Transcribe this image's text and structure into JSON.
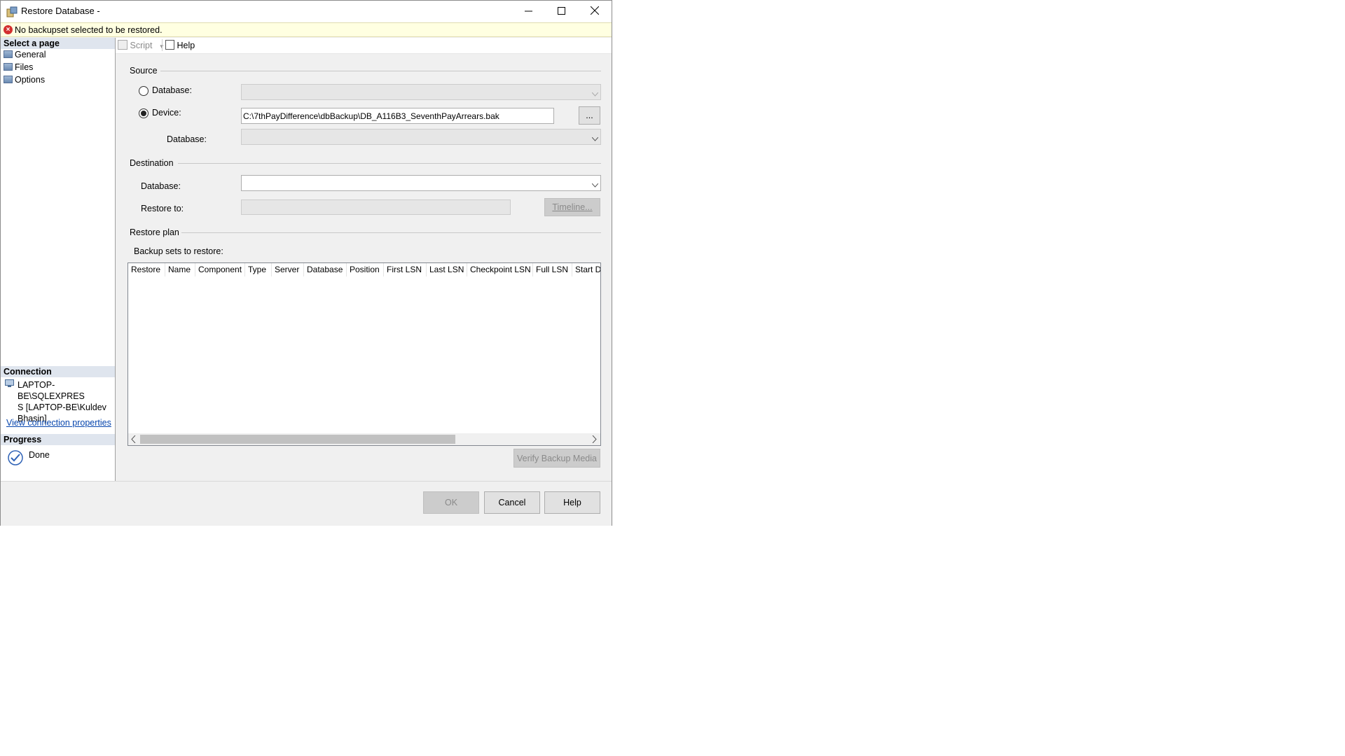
{
  "window": {
    "title": "Restore Database -",
    "minimize_icon": "minimize-icon",
    "maximize_icon": "maximize-icon",
    "close_icon": "close-icon"
  },
  "error": {
    "icon": "error-icon",
    "message": "No backupset selected to be restored."
  },
  "left": {
    "select_page_header": "Select a page",
    "pages": [
      {
        "label": "General",
        "icon": "page-icon"
      },
      {
        "label": "Files",
        "icon": "page-icon"
      },
      {
        "label": "Options",
        "icon": "page-icon"
      }
    ],
    "connection_header": "Connection",
    "connection_text_1": "LAPTOP-BE\\SQLEXPRES",
    "connection_text_2": "S [LAPTOP-BE\\Kuldev",
    "connection_text_3": "Bhasin]",
    "view_connection_link": "View connection properties",
    "progress_header": "Progress",
    "progress_status": "Done"
  },
  "toolbar": {
    "script_label": "Script",
    "help_label": "Help"
  },
  "source": {
    "group_label": "Source",
    "database_radio_label": "Database:",
    "device_radio_label": "Device:",
    "device_path": "C:\\7thPayDifference\\dbBackup\\DB_A116B3_SeventhPayArrears.bak",
    "browse_label": "...",
    "device_database_label": "Database:",
    "selected": "device"
  },
  "destination": {
    "group_label": "Destination",
    "database_label": "Database:",
    "restore_to_label": "Restore to:",
    "timeline_label": "Timeline..."
  },
  "restore_plan": {
    "group_label": "Restore plan",
    "backup_sets_label": "Backup sets to restore:",
    "columns": [
      "Restore",
      "Name",
      "Component",
      "Type",
      "Server",
      "Database",
      "Position",
      "First LSN",
      "Last LSN",
      "Checkpoint LSN",
      "Full LSN",
      "Start D"
    ],
    "verify_label": "Verify Backup Media"
  },
  "footer": {
    "ok_label": "OK",
    "cancel_label": "Cancel",
    "help_label": "Help"
  }
}
